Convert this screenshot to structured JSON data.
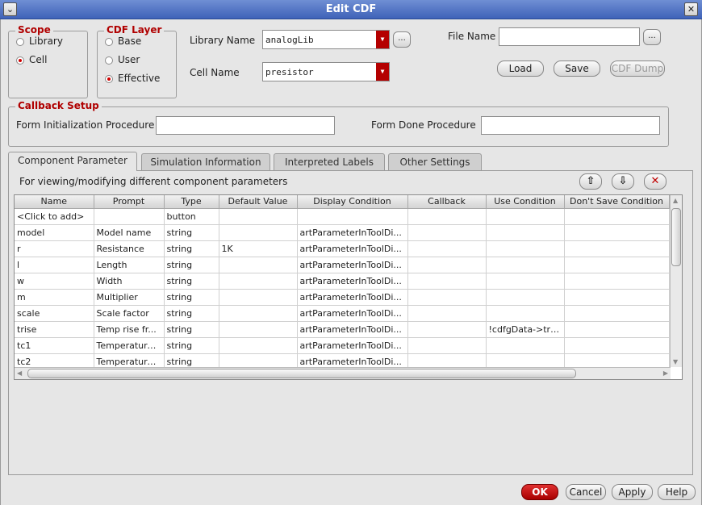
{
  "window": {
    "title": "Edit CDF"
  },
  "scope": {
    "legend": "Scope",
    "options": [
      {
        "label": "Library",
        "selected": false
      },
      {
        "label": "Cell",
        "selected": true
      }
    ]
  },
  "cdf_layer": {
    "legend": "CDF Layer",
    "options": [
      {
        "label": "Base",
        "selected": false
      },
      {
        "label": "User",
        "selected": false
      },
      {
        "label": "Effective",
        "selected": true
      }
    ]
  },
  "library": {
    "label": "Library Name",
    "value": "analogLib",
    "browse": "..."
  },
  "cell": {
    "label": "Cell Name",
    "value": "presistor"
  },
  "file": {
    "label": "File Name",
    "value": "",
    "browse": "..."
  },
  "file_buttons": {
    "load": "Load",
    "save": "Save",
    "dump": "CDF Dump"
  },
  "callback": {
    "legend": "Callback Setup",
    "init_label": "Form Initialization Procedure",
    "init_value": "",
    "done_label": "Form Done Procedure",
    "done_value": ""
  },
  "tabs": [
    {
      "label": "Component Parameter",
      "active": true
    },
    {
      "label": "Simulation Information",
      "active": false
    },
    {
      "label": "Interpreted Labels",
      "active": false
    },
    {
      "label": "Other Settings",
      "active": false
    }
  ],
  "panel": {
    "description": "For viewing/modifying different component parameters"
  },
  "table": {
    "columns": [
      "Name",
      "Prompt",
      "Type",
      "Default Value",
      "Display Condition",
      "Callback",
      "Use Condition",
      "Don't Save Condition"
    ],
    "rows": [
      [
        "<Click to add>",
        "",
        "button",
        "",
        "",
        "",
        "",
        ""
      ],
      [
        "model",
        "Model name",
        "string",
        "",
        "artParameterInToolDi...",
        "",
        "",
        ""
      ],
      [
        "r",
        "Resistance",
        "string",
        "1K",
        "artParameterInToolDi...",
        "",
        "",
        ""
      ],
      [
        "l",
        "Length",
        "string",
        "",
        "artParameterInToolDi...",
        "",
        "",
        ""
      ],
      [
        "w",
        "Width",
        "string",
        "",
        "artParameterInToolDi...",
        "",
        "",
        ""
      ],
      [
        "m",
        "Multiplier",
        "string",
        "",
        "artParameterInToolDi...",
        "",
        "",
        ""
      ],
      [
        "scale",
        "Scale factor",
        "string",
        "",
        "artParameterInToolDi...",
        "",
        "",
        ""
      ],
      [
        "trise",
        "Temp rise fr...",
        "string",
        "",
        "artParameterInToolDi...",
        "",
        "!cdfgData->tri...",
        ""
      ],
      [
        "tc1",
        "Temperature...",
        "string",
        "",
        "artParameterInToolDi...",
        "",
        "",
        ""
      ],
      [
        "tc2",
        "Temperature...",
        "string",
        "",
        "artParameterInToolDi...",
        "",
        "",
        ""
      ]
    ]
  },
  "footer": {
    "ok": "OK",
    "cancel": "Cancel",
    "apply": "Apply",
    "help": "Help"
  },
  "colors": {
    "accent": "#b40000",
    "titlebar": "#4a6cc0"
  }
}
